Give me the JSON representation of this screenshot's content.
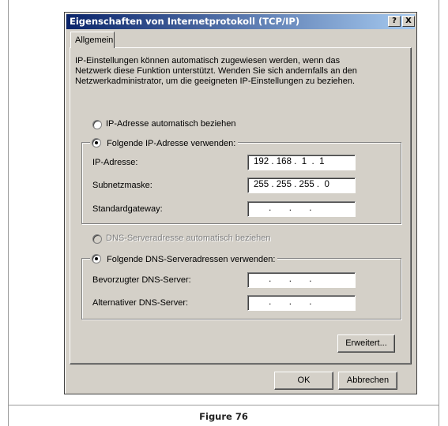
{
  "window": {
    "title": "Eigenschaften von Internetprotokoll (TCP/IP)",
    "help_button": "?",
    "close_button": "X"
  },
  "tab": {
    "label": "Allgemein"
  },
  "intro_text": "IP-Einstellungen können automatisch zugewiesen werden, wenn das Netzwerk diese Funktion unterstützt. Wenden Sie sich andernfalls an den Netzwerkadministrator, um die geeigneten IP-Einstellungen zu beziehen.",
  "ip": {
    "auto_label": "IP-Adresse automatisch beziehen",
    "manual_label": "Folgende IP-Adresse verwenden:",
    "selected": "manual",
    "fields": [
      {
        "label": "IP-Adresse:",
        "value": "192 . 168 .  1  .  1"
      },
      {
        "label": "Subnetzmaske:",
        "value": "255 . 255 . 255 .  0"
      },
      {
        "label": "Standardgateway:",
        "value": "      .       .       ."
      }
    ]
  },
  "dns": {
    "auto_label": "DNS-Serveradresse automatisch beziehen",
    "manual_label": "Folgende DNS-Serveradressen verwenden:",
    "selected": "manual",
    "auto_disabled": true,
    "fields": [
      {
        "label": "Bevorzugter DNS-Server:",
        "value": "      .       .       ."
      },
      {
        "label": "Alternativer DNS-Server:",
        "value": "      .       .       ."
      }
    ]
  },
  "buttons": {
    "advanced": "Erweitert...",
    "ok": "OK",
    "cancel": "Abbrechen"
  },
  "caption": "Figure 76"
}
